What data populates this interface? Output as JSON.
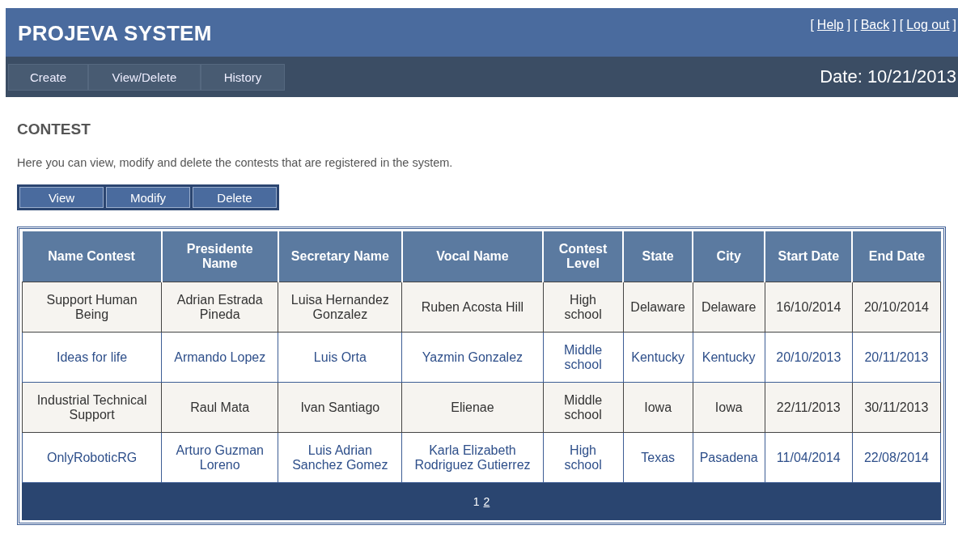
{
  "header": {
    "title": "PROJEVA SYSTEM",
    "links": [
      {
        "open": "[",
        "label": "Help",
        "close": "]"
      },
      {
        "open": "[",
        "label": "Back",
        "close": "]"
      },
      {
        "open": "[",
        "label": "Log out",
        "close": "]"
      }
    ]
  },
  "nav": {
    "tabs": [
      "Create",
      "View/Delete",
      "History"
    ],
    "date": "Date: 10/21/2013"
  },
  "section": {
    "title": "CONTEST",
    "description": "Here you can view, modify and delete the contests that are registered in the system."
  },
  "actions": [
    "View",
    "Modify",
    "Delete"
  ],
  "table": {
    "columns": [
      "Name Contest",
      "Presidente Name",
      "Secretary Name",
      "Vocal Name",
      "Contest Level",
      "State",
      "City",
      "Start Date",
      "End Date"
    ],
    "rows": [
      [
        "Support Human Being",
        "Adrian Estrada Pineda",
        "Luisa Hernandez Gonzalez",
        "Ruben Acosta Hill",
        "High school",
        "Delaware",
        "Delaware",
        "16/10/2014",
        "20/10/2014"
      ],
      [
        "Ideas for life",
        "Armando Lopez",
        "Luis Orta",
        "Yazmin Gonzalez",
        "Middle school",
        "Kentucky",
        "Kentucky",
        "20/10/2013",
        "20/11/2013"
      ],
      [
        "Industrial Technical Support",
        "Raul Mata",
        "Ivan Santiago",
        "Elienae",
        "Middle school",
        "Iowa",
        "Iowa",
        "22/11/2013",
        "30/11/2013"
      ],
      [
        "OnlyRoboticRG",
        "Arturo Guzman Loreno",
        "Luis Adrian Sanchez Gomez",
        "Karla Elizabeth Rodriguez Gutierrez",
        "High school",
        "Texas",
        "Pasadena",
        "11/04/2014",
        "22/08/2014"
      ]
    ],
    "pages": [
      {
        "label": "1",
        "selected": true
      },
      {
        "label": "2",
        "selected": false
      }
    ]
  }
}
